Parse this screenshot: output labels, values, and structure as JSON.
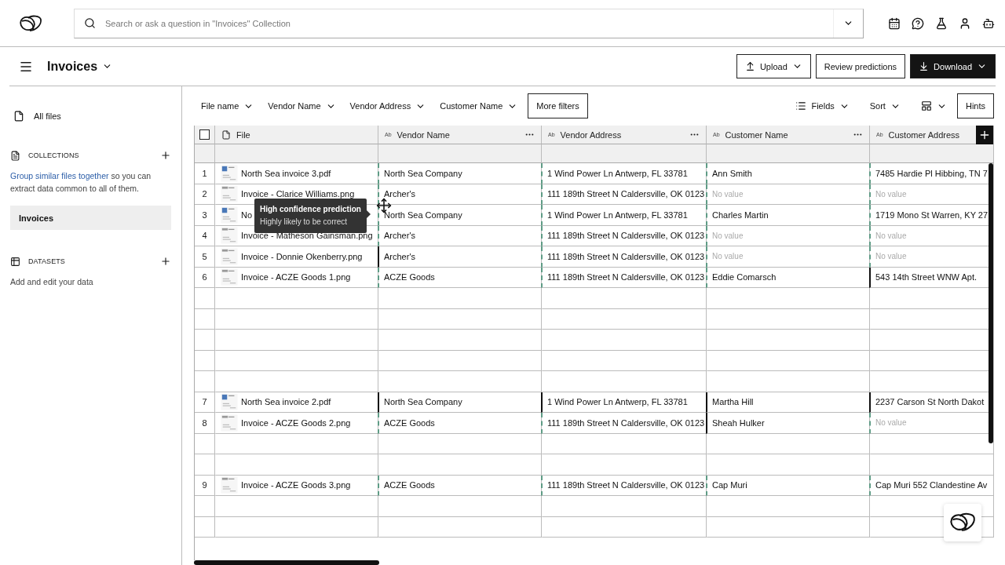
{
  "app_bar": {
    "search": {
      "placeholder": "Search or ask a question in \"Invoices\" Collection"
    }
  },
  "header": {
    "title": "Invoices",
    "buttons": [
      {
        "label": "Upload",
        "kind": "upload"
      },
      {
        "label": "Review predictions",
        "kind": "plain"
      },
      {
        "label": "Download",
        "kind": "primary"
      }
    ]
  },
  "sidebar": {
    "all_files": "All files",
    "sections": [
      {
        "title": "COLLECTIONS",
        "kind": "collections",
        "link": "Group similar files together",
        "text": " so you can extract data common to all of them.",
        "items": [
          {
            "label": "Invoices",
            "selected": true
          }
        ]
      },
      {
        "title": "DATASETS",
        "kind": "datasets",
        "text": "Add and edit your data"
      }
    ]
  },
  "filters": [
    "File name",
    "Vendor Name",
    "Vendor Address",
    "Customer Name"
  ],
  "more_filters": "More filters",
  "view_controls": [
    {
      "kind": "fields",
      "label": "Fields"
    },
    {
      "kind": "sort",
      "label": "Sort"
    },
    {
      "kind": "layout"
    }
  ],
  "hints": "Hints",
  "table": {
    "select_all": {
      "checked": false
    },
    "columns": [
      {
        "label": "File",
        "kind": "file",
        "menu": false
      },
      {
        "label": "Vendor Name",
        "kind": "text",
        "type_label": "Ab",
        "menu": true
      },
      {
        "label": "Vendor Address",
        "kind": "text",
        "type_label": "Ab",
        "menu": true
      },
      {
        "label": "Customer Name",
        "kind": "text",
        "type_label": "Ab",
        "menu": true
      },
      {
        "label": "Customer Address",
        "kind": "text",
        "type_label": "Ab",
        "menu": false
      }
    ],
    "rows": [
      {
        "kind": "record",
        "number": "1",
        "thumbnail_logo": true,
        "file": "North Sea invoice 3.pdf",
        "cells": [
          {
            "text": "North Sea Company",
            "confirmed": false,
            "empty": false
          },
          {
            "text": "1 Wind Power Ln Antwerp, FL 33781",
            "confirmed": false,
            "empty": false
          },
          {
            "text": "Ann Smith",
            "confirmed": false,
            "empty": false
          },
          {
            "text": "7485 Hardie Pl Hibbing, TN 7",
            "confirmed": false,
            "empty": false
          }
        ]
      },
      {
        "kind": "record",
        "number": "2",
        "thumbnail_logo": false,
        "file": "Invoice - Clarice Williams.png",
        "cells": [
          {
            "text": "Archer's",
            "confirmed": false,
            "empty": false
          },
          {
            "text": "111 189th Street N Caldersville, OK 0123",
            "confirmed": false,
            "empty": false
          },
          {
            "text": "No value",
            "confirmed": false,
            "empty": true
          },
          {
            "text": "No value",
            "confirmed": false,
            "empty": true
          }
        ]
      },
      {
        "kind": "record",
        "number": "3",
        "thumbnail_logo": true,
        "file": "No",
        "cells": [
          {
            "text": "North Sea Company",
            "confirmed": false,
            "empty": false
          },
          {
            "text": "1 Wind Power Ln Antwerp, FL 33781",
            "confirmed": false,
            "empty": false
          },
          {
            "text": "Charles Martin",
            "confirmed": false,
            "empty": false
          },
          {
            "text": "1719 Mono St Warren, KY 27",
            "confirmed": false,
            "empty": false
          }
        ]
      },
      {
        "kind": "record",
        "number": "4",
        "thumbnail_logo": false,
        "file": "Invoice - Matheson Gainsman.png",
        "cells": [
          {
            "text": "Archer's",
            "confirmed": false,
            "empty": false
          },
          {
            "text": "111 189th Street N Caldersville, OK 0123",
            "confirmed": false,
            "empty": false
          },
          {
            "text": "No value",
            "confirmed": false,
            "empty": true
          },
          {
            "text": "No value",
            "confirmed": false,
            "empty": true
          }
        ]
      },
      {
        "kind": "record",
        "number": "5",
        "thumbnail_logo": false,
        "file": "Invoice - Donnie Okenberry.png",
        "cells": [
          {
            "text": "Archer's",
            "confirmed": true,
            "empty": false
          },
          {
            "text": "111 189th Street N Caldersville, OK 0123",
            "confirmed": false,
            "empty": false
          },
          {
            "text": "No value",
            "confirmed": false,
            "empty": true
          },
          {
            "text": "No value",
            "confirmed": false,
            "empty": true
          }
        ]
      },
      {
        "kind": "record",
        "number": "6",
        "thumbnail_logo": false,
        "file": "Invoice - ACZE Goods 1.png",
        "cells": [
          {
            "text": "ACZE Goods",
            "confirmed": false,
            "empty": false
          },
          {
            "text": "111 189th Street N Caldersville, OK 0123",
            "confirmed": false,
            "empty": false
          },
          {
            "text": "Eddie Comarsch",
            "confirmed": false,
            "empty": false
          },
          {
            "text": "543 14th Street WNW Apt.",
            "confirmed": true,
            "empty": false
          }
        ]
      },
      {
        "kind": "blank"
      },
      {
        "kind": "blank"
      },
      {
        "kind": "blank"
      },
      {
        "kind": "blank"
      },
      {
        "kind": "blank"
      },
      {
        "kind": "record",
        "number": "7",
        "thumbnail_logo": true,
        "file": "North Sea invoice 2.pdf",
        "cells": [
          {
            "text": "North Sea Company",
            "confirmed": true,
            "empty": false
          },
          {
            "text": "1 Wind Power Ln Antwerp, FL 33781",
            "confirmed": true,
            "empty": false
          },
          {
            "text": "Martha Hill",
            "confirmed": true,
            "empty": false
          },
          {
            "text": "2237 Carson St North Dakot",
            "confirmed": true,
            "empty": false
          }
        ]
      },
      {
        "kind": "record",
        "number": "8",
        "thumbnail_logo": false,
        "file": "Invoice - ACZE Goods 2.png",
        "cells": [
          {
            "text": "ACZE Goods",
            "confirmed": false,
            "empty": false
          },
          {
            "text": "111 189th Street N Caldersville, OK 0123",
            "confirmed": false,
            "empty": false
          },
          {
            "text": "Sheah Hulker",
            "confirmed": true,
            "empty": false
          },
          {
            "text": "No value",
            "confirmed": false,
            "empty": true
          }
        ]
      },
      {
        "kind": "blank"
      },
      {
        "kind": "blank"
      },
      {
        "kind": "record",
        "number": "9",
        "thumbnail_logo": false,
        "file": "Invoice - ACZE Goods 3.png",
        "cells": [
          {
            "text": "ACZE Goods",
            "confirmed": false,
            "empty": false
          },
          {
            "text": "111 189th Street N Caldersville, OK 0123",
            "confirmed": false,
            "empty": false
          },
          {
            "text": "Cap Muri",
            "confirmed": false,
            "empty": false
          },
          {
            "text": "Cap Muri 552 Clandestine Av",
            "confirmed": false,
            "empty": false
          }
        ]
      },
      {
        "kind": "blank"
      },
      {
        "kind": "blank"
      }
    ]
  },
  "tooltip": {
    "title": "High confidence prediction",
    "text": "Highly likely to be correct"
  }
}
